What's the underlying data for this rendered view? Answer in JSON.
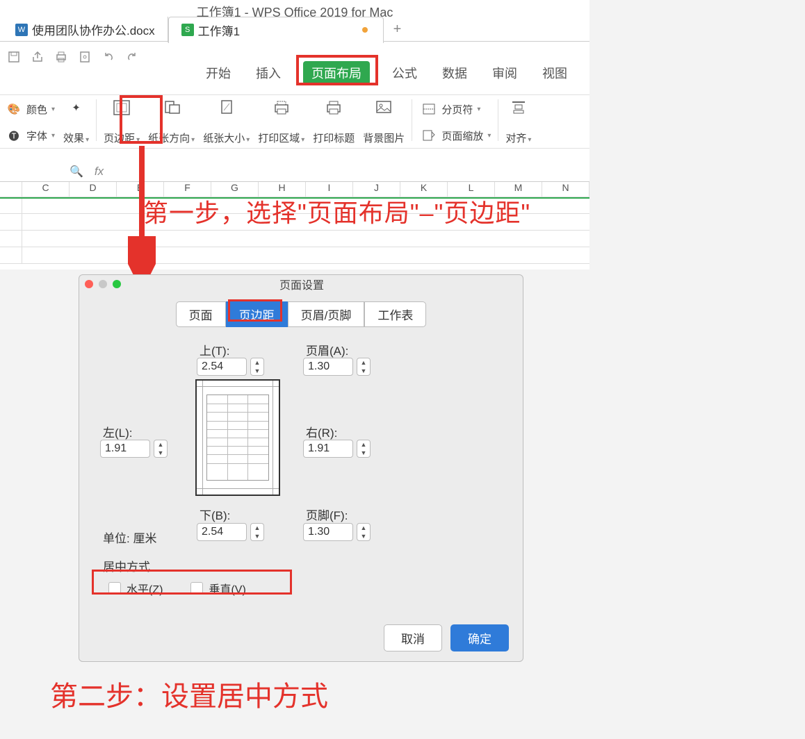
{
  "window": {
    "title": "工作簿1 - WPS Office 2019 for Mac",
    "tabs": [
      {
        "icon": "W",
        "label": "使用团队协作办公.docx"
      },
      {
        "icon": "S",
        "label": "工作簿1",
        "modified": true
      }
    ],
    "plus": "+"
  },
  "menu": {
    "items": [
      "开始",
      "插入",
      "页面布局",
      "公式",
      "数据",
      "审阅",
      "视图"
    ],
    "active": "页面布局"
  },
  "ribbon": {
    "color": "颜色",
    "font": "字体",
    "effect": "效果",
    "margins": "页边距",
    "orientation": "纸张方向",
    "size": "纸张大小",
    "printArea": "打印区域",
    "printTitles": "打印标题",
    "background": "背景图片",
    "breaks": "分页符",
    "zoom": "页面缩放",
    "align": "对齐"
  },
  "formula_bar": {
    "fx": "fx"
  },
  "columns": [
    "",
    "C",
    "D",
    "E",
    "F",
    "G",
    "H",
    "I",
    "J",
    "K",
    "L",
    "M",
    "N"
  ],
  "annotation": {
    "step1": "第一步，选择\"页面布局\"–\"页边距\"",
    "step2": "第二步：设置居中方式"
  },
  "dialog": {
    "title": "页面设置",
    "tabs": [
      "页面",
      "页边距",
      "页眉/页脚",
      "工作表"
    ],
    "activeTab": "页边距",
    "labels": {
      "top": "上(T):",
      "header": "页眉(A):",
      "left": "左(L):",
      "right": "右(R):",
      "bottom": "下(B):",
      "footer": "页脚(F):",
      "unit": "单位: 厘米",
      "centerTitle": "居中方式",
      "horizontal": "水平(Z)",
      "vertical": "垂直(V)"
    },
    "values": {
      "top": "2.54",
      "header": "1.30",
      "left": "1.91",
      "right": "1.91",
      "bottom": "2.54",
      "footer": "1.30"
    },
    "buttons": {
      "cancel": "取消",
      "ok": "确定"
    }
  }
}
